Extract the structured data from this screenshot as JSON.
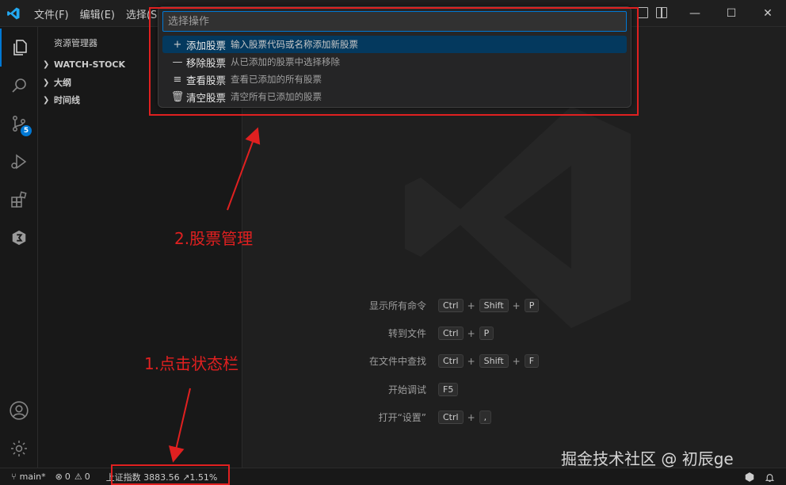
{
  "menu": [
    "文件(F)",
    "编辑(E)",
    "选择(S)"
  ],
  "window_controls": {
    "minimize": "—",
    "maximize": "☐",
    "close": "✕"
  },
  "activity_bar": {
    "icons": [
      "explorer-icon",
      "search-icon",
      "source-control-icon",
      "run-debug-icon",
      "extensions-icon",
      "stock-extension-icon",
      "accounts-icon",
      "settings-gear-icon"
    ],
    "source_control_badge": "5"
  },
  "sidebar": {
    "title": "资源管理器",
    "sections": [
      "WATCH-STOCK",
      "大纲",
      "时间线"
    ]
  },
  "quick_pick": {
    "placeholder": "选择操作",
    "items": [
      {
        "icon": "+",
        "label": "添加股票",
        "description": "输入股票代码或名称添加新股票"
      },
      {
        "icon": "—",
        "label": "移除股票",
        "description": "从已添加的股票中选择移除"
      },
      {
        "icon": "≡",
        "label": "查看股票",
        "description": "查看已添加的所有股票"
      },
      {
        "icon": "🗑",
        "label": "清空股票",
        "description": "清空所有已添加的股票"
      }
    ]
  },
  "shortcuts": [
    {
      "label": "显示所有命令",
      "keys": [
        "Ctrl",
        "Shift",
        "P"
      ]
    },
    {
      "label": "转到文件",
      "keys": [
        "Ctrl",
        "P"
      ]
    },
    {
      "label": "在文件中查找",
      "keys": [
        "Ctrl",
        "Shift",
        "F"
      ]
    },
    {
      "label": "开始调试",
      "keys": [
        "F5"
      ]
    },
    {
      "label": "打开“设置”",
      "keys": [
        "Ctrl",
        ","
      ]
    }
  ],
  "status_bar": {
    "branch": "main*",
    "errors": "0",
    "warnings": "0",
    "stock_index": "上证指数 3883.56 ↗1.51%"
  },
  "annotations": {
    "step1": "1.点击状态栏",
    "step2": "2.股票管理"
  },
  "watermark": "掘金技术社区 @ 初辰ge",
  "colors": {
    "accent": "#0078d4",
    "annotation": "#e02020",
    "selection": "#04395e"
  }
}
